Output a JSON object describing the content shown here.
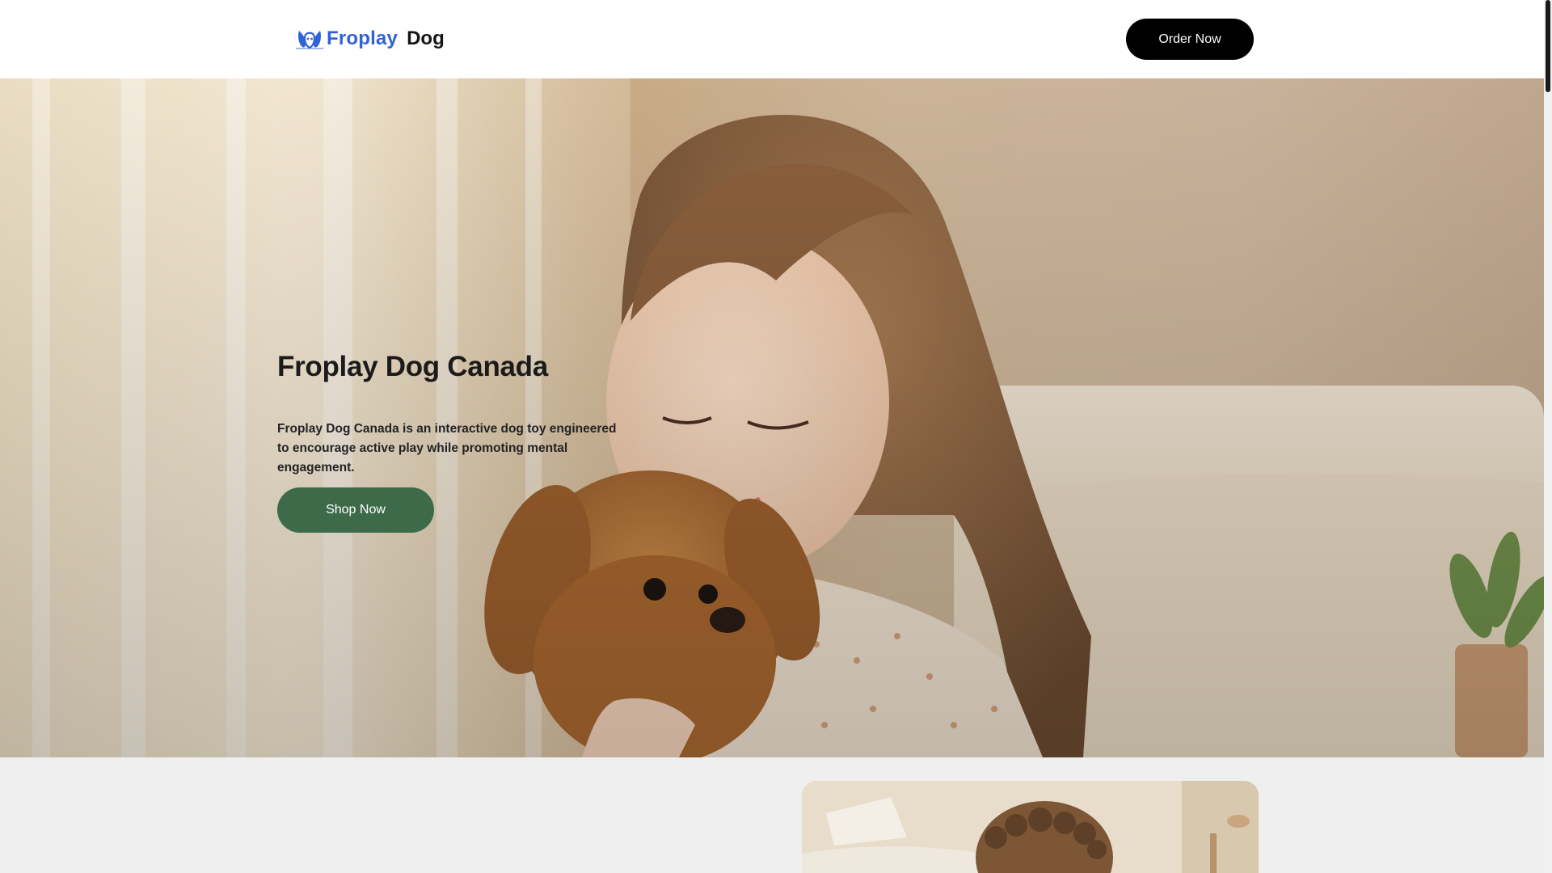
{
  "header": {
    "brand_primary": "Froplay",
    "brand_secondary": "Dog",
    "order_button_label": "Order Now"
  },
  "hero": {
    "title": "Froplay Dog Canada",
    "description": "Froplay Dog Canada is an interactive dog toy engineered to encourage active play while promoting mental engagement.",
    "cta_label": "Shop Now"
  },
  "colors": {
    "brand_blue": "#2f63d6",
    "order_button": "#000000",
    "shop_button": "#3d6b4a",
    "section_bg": "#efefef"
  },
  "icons": {
    "logo": "froplay-dog-logo-icon"
  }
}
